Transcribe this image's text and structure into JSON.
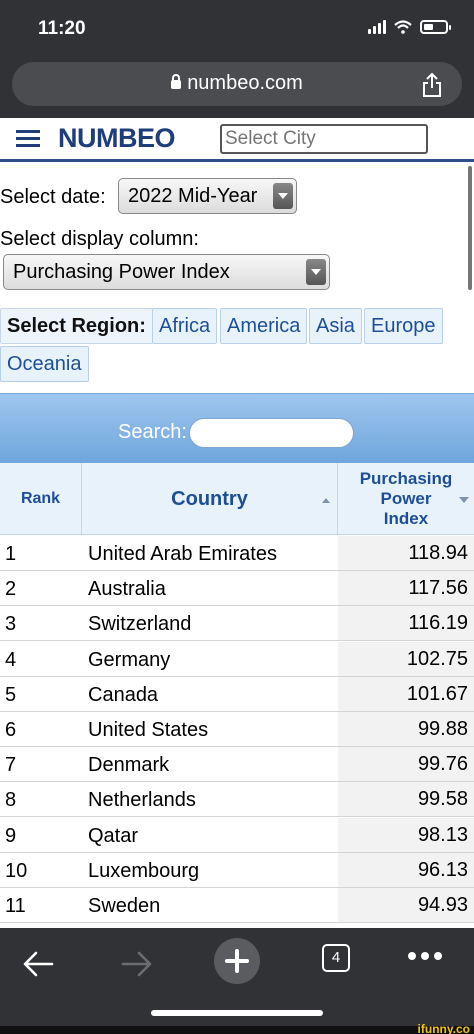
{
  "status": {
    "time": "11:20"
  },
  "browser": {
    "url": "numbeo.com"
  },
  "site": {
    "logo": "NUMBEO",
    "city_placeholder": "Select City"
  },
  "controls": {
    "date_label": "Select date:",
    "date_value": "2022 Mid-Year",
    "column_label": "Select display column:",
    "column_value": "Purchasing Power Index"
  },
  "regions": {
    "title": "Select Region:",
    "items": [
      "Africa",
      "America",
      "Asia",
      "Europe",
      "Oceania"
    ]
  },
  "search": {
    "label": "Search:"
  },
  "table": {
    "headers": {
      "rank": "Rank",
      "country": "Country",
      "ppi": [
        "Purchasing",
        "Power",
        "Index"
      ]
    },
    "rows": [
      {
        "rank": "1",
        "country": "United Arab Emirates",
        "value": "118.94"
      },
      {
        "rank": "2",
        "country": "Australia",
        "value": "117.56"
      },
      {
        "rank": "3",
        "country": "Switzerland",
        "value": "116.19"
      },
      {
        "rank": "4",
        "country": "Germany",
        "value": "102.75"
      },
      {
        "rank": "5",
        "country": "Canada",
        "value": "101.67"
      },
      {
        "rank": "6",
        "country": "United States",
        "value": "99.88"
      },
      {
        "rank": "7",
        "country": "Denmark",
        "value": "99.76"
      },
      {
        "rank": "8",
        "country": "Netherlands",
        "value": "99.58"
      },
      {
        "rank": "9",
        "country": "Qatar",
        "value": "98.13"
      },
      {
        "rank": "10",
        "country": "Luxembourg",
        "value": "96.13"
      },
      {
        "rank": "11",
        "country": "Sweden",
        "value": "94.93"
      }
    ]
  },
  "toolbar": {
    "tab_count": "4"
  },
  "watermark": "ifunny.co"
}
